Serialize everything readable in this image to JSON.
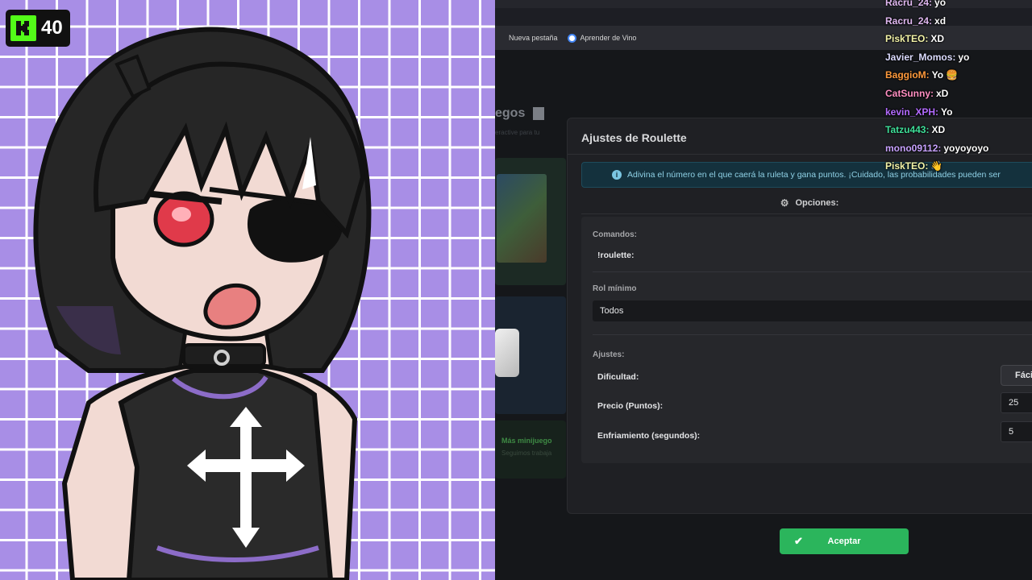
{
  "badge": {
    "count": "40",
    "logo": "kick-k-logo",
    "color": "#53fc18"
  },
  "browser": {
    "bookmarks": [
      {
        "label": "Nueva pestaña"
      },
      {
        "label": "Aprender de Vino",
        "icon": "google-icon"
      }
    ]
  },
  "background_page": {
    "title": "egos",
    "subtitle": "eractive para tu",
    "footer_title": "Más minijuego",
    "footer_sub": "Seguimos trabaja"
  },
  "dialog": {
    "title": "Ajustes de Roulette",
    "alert": "Adivina el número en el que caerá la ruleta y gana puntos. ¡Cuidado, las probabilidades pueden ser",
    "options_label": "Opciones:",
    "commands_label": "Comandos:",
    "command": "!roulette:",
    "min_role_label": "Rol mínimo",
    "min_role_value": "Todos",
    "settings_label": "Ajustes:",
    "difficulty_label": "Dificultad:",
    "difficulty_value": "Fáci",
    "price_label": "Precio (Puntos):",
    "price_value": "25",
    "cooldown_label": "Enfriamiento (segundos):",
    "cooldown_value": "5",
    "accept_label": "Aceptar",
    "accept_color": "#2bb55c"
  },
  "chat": [
    {
      "user": "Racru_24:",
      "text": "yo",
      "color": "#e0b8f0"
    },
    {
      "user": "Racru_24:",
      "text": "xd",
      "color": "#e0b8f0"
    },
    {
      "user": "PiskTEO:",
      "text": "XD",
      "color": "#f4f4a8"
    },
    {
      "user": "Javier_Momos:",
      "text": "yo",
      "color": "#dcdcff"
    },
    {
      "user": "BaggioM:",
      "text": "Yo 🍔",
      "color": "#ff9a3c"
    },
    {
      "user": "CatSunny:",
      "text": "xD",
      "color": "#ff8fc2"
    },
    {
      "user": "kevin_XPH:",
      "text": "Yo",
      "color": "#b36bff"
    },
    {
      "user": "Tatzu443:",
      "text": "XD",
      "color": "#3fe09a"
    },
    {
      "user": "mono09112:",
      "text": "yoyoyoyo",
      "color": "#c8a2ff"
    },
    {
      "user": "PiskTEO:",
      "text": "👋",
      "color": "#f4f4a8"
    }
  ]
}
